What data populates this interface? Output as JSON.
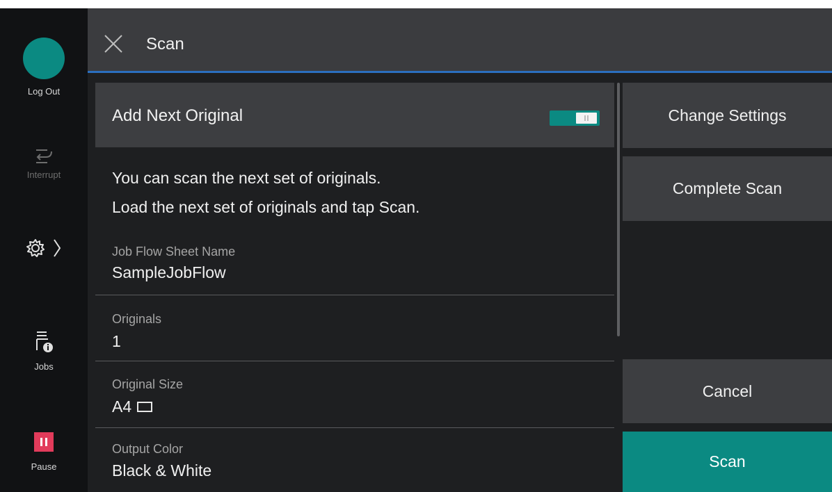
{
  "rail": {
    "logout_label": "Log Out",
    "interrupt_label": "Interrupt",
    "jobs_label": "Jobs",
    "pause_label": "Pause"
  },
  "header": {
    "title": "Scan"
  },
  "add_next": {
    "label": "Add Next Original",
    "toggle_on": true
  },
  "message": {
    "line1": "You can scan the next set of originals.",
    "line2": "Load the next set of originals and tap Scan."
  },
  "fields": [
    {
      "label": "Job Flow Sheet Name",
      "value": "SampleJobFlow"
    },
    {
      "label": "Originals",
      "value": "1"
    },
    {
      "label": "Original Size",
      "value": "A4"
    },
    {
      "label": "Output Color",
      "value": "Black & White"
    }
  ],
  "buttons": {
    "change_settings": "Change Settings",
    "complete_scan": "Complete Scan",
    "cancel": "Cancel",
    "scan": "Scan"
  },
  "colors": {
    "accent_teal": "#0b8a82",
    "pause_red": "#e23b5b",
    "header_blue_line": "#2b6fbf"
  },
  "icons": {
    "close": "close-icon",
    "settings": "gear-icon",
    "interrupt": "interrupt-icon",
    "jobs": "jobs-icon",
    "pause": "pause-icon"
  }
}
